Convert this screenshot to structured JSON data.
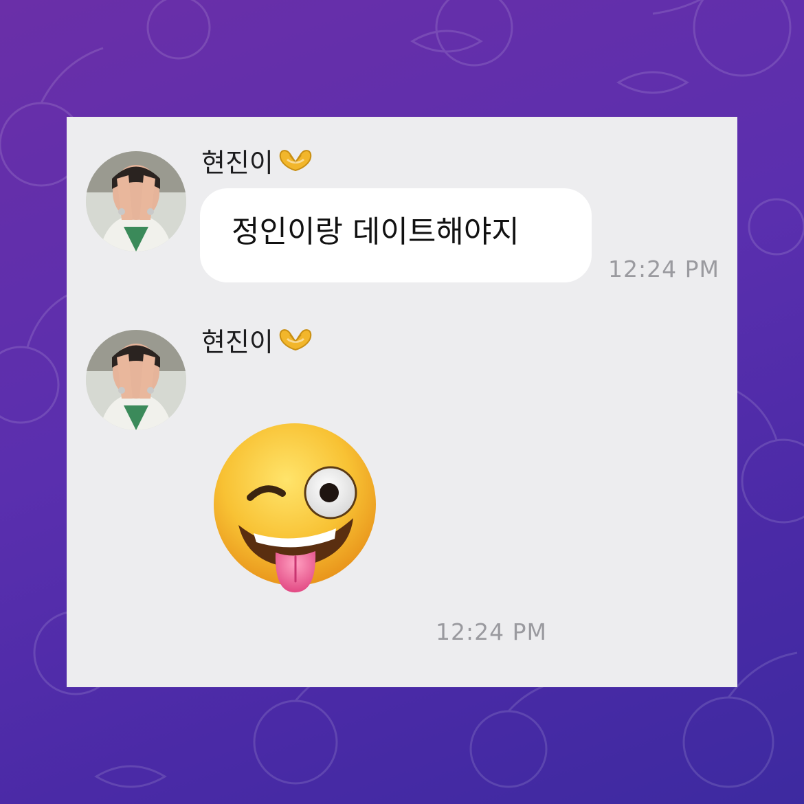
{
  "messages": [
    {
      "sender": "현진이",
      "sender_emoji": "heart-hands-icon",
      "text": "정인이랑 데이트해야지",
      "time": "12:24 PM"
    },
    {
      "sender": "현진이",
      "sender_emoji": "heart-hands-icon",
      "sticker": "winking-face-with-tongue-icon",
      "time": "12:24 PM"
    }
  ],
  "colors": {
    "background_top": "#6a2fa8",
    "background_bottom": "#3d2aa0",
    "card": "#ededef",
    "bubble": "#ffffff",
    "time": "#9a9a9f"
  }
}
